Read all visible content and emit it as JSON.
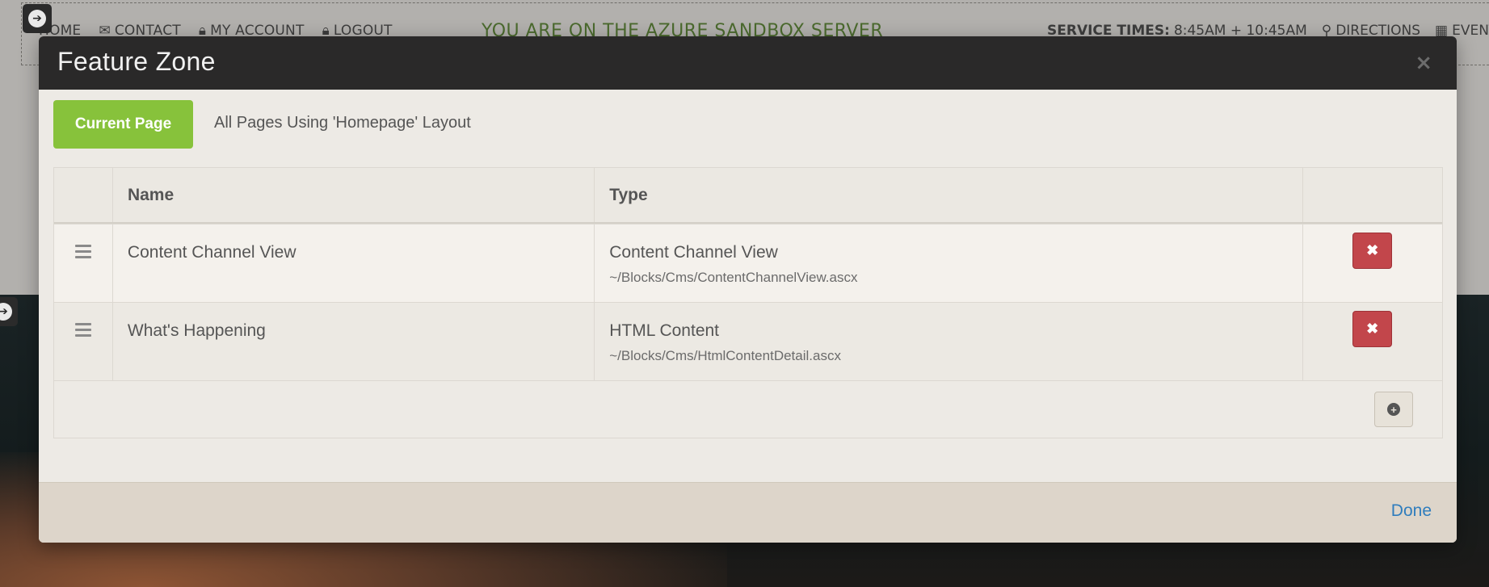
{
  "background": {
    "nav_left": [
      {
        "icon": "home-icon",
        "label": "HOME"
      },
      {
        "icon": "envelope-icon",
        "label": "CONTACT"
      },
      {
        "icon": "lock-icon",
        "label": "MY ACCOUNT"
      },
      {
        "icon": "lock-icon",
        "label": "LOGOUT"
      }
    ],
    "nav_center": "YOU ARE ON THE AZURE SANDBOX SERVER",
    "nav_right": {
      "service_label": "SERVICE TIMES:",
      "service_times": "8:45AM + 10:45AM",
      "directions": "DIRECTIONS",
      "events": "EVENTS"
    }
  },
  "modal": {
    "title": "Feature Zone",
    "close_glyph": "×",
    "scope_pills": {
      "current": "Current Page",
      "all": "All Pages Using 'Homepage' Layout"
    },
    "grid": {
      "columns": [
        "Name",
        "Type"
      ],
      "rows": [
        {
          "name": "Content Channel View",
          "type": "Content Channel View",
          "path": "~/Blocks/Cms/ContentChannelView.ascx"
        },
        {
          "name": "What's Happening",
          "type": "HTML Content",
          "path": "~/Blocks/Cms/HtmlContentDetail.ascx"
        }
      ]
    },
    "done_label": "Done"
  },
  "colors": {
    "accent_green": "#87c23b",
    "danger_red": "#c2464b",
    "link_blue": "#2f7dbd",
    "header_dark": "#2a2929"
  }
}
